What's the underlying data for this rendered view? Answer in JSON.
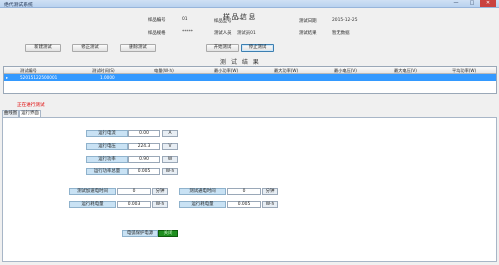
{
  "window": {
    "title": "绝代测试系统",
    "min": "—",
    "max": "□",
    "close": "✕"
  },
  "sample": {
    "header": "样品信息",
    "fields": [
      {
        "label": "样品编号",
        "value": "01"
      },
      {
        "label": "样品型号",
        "value": "***"
      },
      {
        "label": "测试日期",
        "value": "2015-12-25"
      },
      {
        "label": "样品规格",
        "value": "*****"
      },
      {
        "label": "测试人员",
        "value": "测试员01"
      },
      {
        "label": "测试结果",
        "value": "暂无数据"
      }
    ]
  },
  "toolbar": {
    "buttons": [
      "新建测试",
      "修正测试",
      "删除测试",
      "开始测试",
      "停止测试"
    ]
  },
  "results": {
    "header": "测 试 结 果",
    "columns": [
      "测试编号",
      "测试时间(S)",
      "电量(W·h)",
      "最小功率(W)",
      "最大功率(W)",
      "最小电压(V)",
      "最大电压(V)",
      "平均功率(W)"
    ],
    "rows": [
      [
        "52015122500001",
        "1.0000",
        "",
        "",
        "",
        "",
        "",
        ""
      ]
    ]
  },
  "status": "正在进行测试",
  "tabs": [
    "曲线图",
    "运行界面"
  ],
  "run": {
    "rows": [
      {
        "label": "运行电流",
        "value": "0.00",
        "unit": "A"
      },
      {
        "label": "运行电压",
        "value": "224.3",
        "unit": "V"
      },
      {
        "label": "运行功率",
        "value": "0.90",
        "unit": "W"
      },
      {
        "label": "运行功率总量",
        "value": "0.005",
        "unit": "W·h"
      }
    ],
    "timing": [
      {
        "label": "测试加速电时间",
        "value": "0",
        "unit": "分钟"
      },
      {
        "label": "测试通电时间",
        "value": "0",
        "unit": "分钟"
      },
      {
        "label": "运行耗电量",
        "value": "0.003",
        "unit": "W·h"
      },
      {
        "label": "运行耗电量",
        "value": "0.005",
        "unit": "W·h"
      }
    ],
    "protect_label": "电弧保护电源",
    "protect_value": "关闭"
  },
  "colors": {
    "selected_row": "#3399ff",
    "status_red": "#e00000",
    "toggle_green": "#1f8f1f"
  }
}
